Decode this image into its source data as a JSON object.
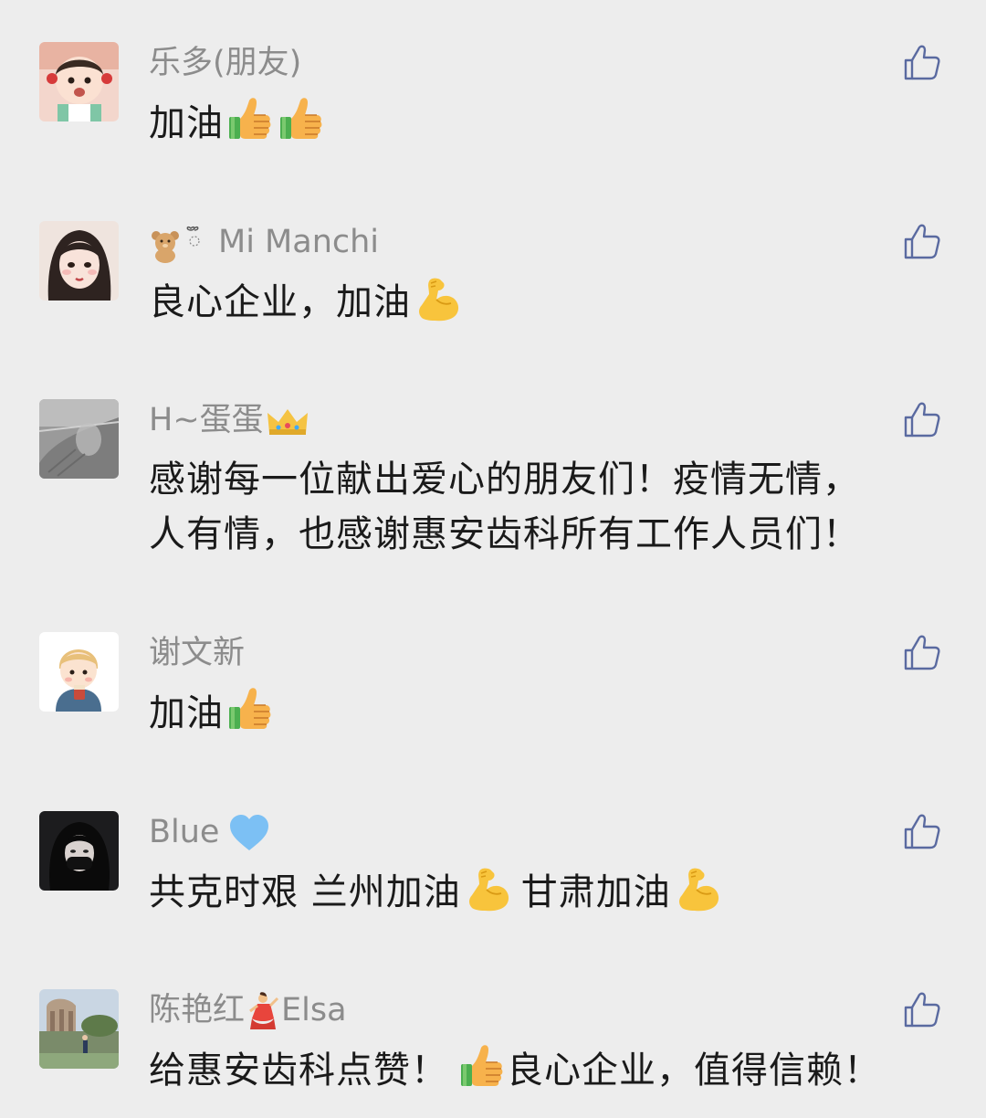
{
  "comments": [
    {
      "name": "乐多(朋友)",
      "text": "加油",
      "emojis": [
        "thumbs-up",
        "thumbs-up"
      ]
    },
    {
      "name_pre_emoji": "teddy-bear",
      "name": "Mi Manchi",
      "text": "良心企业，加油",
      "emojis": [
        "flexed-biceps"
      ]
    },
    {
      "name": "H~蛋蛋",
      "name_emoji": "crown",
      "text": "感谢每一位献出爱心的朋友们！疫情无情，",
      "text2": "人有情，也感谢惠安齿科所有工作人员们！"
    },
    {
      "name": "谢文新",
      "text": "加油",
      "emojis": [
        "thumbs-up"
      ]
    },
    {
      "name": "Blue",
      "name_emoji": "blue-heart",
      "text_a": "共克时艰 兰州加油",
      "text_b": "甘肃加油"
    },
    {
      "name_a": "陈艳红",
      "name_emoji": "dancer",
      "name_b": "Elsa",
      "text_a": "给惠安齿科点赞！",
      "text_b": "良心企业，值得信赖！"
    }
  ],
  "colors": {
    "background": "#ededed",
    "name": "#8c8c8c",
    "text": "#1a1a1a",
    "like_icon": "#5a6aa0"
  },
  "icons": {
    "like": "thumbs-up-outline-icon"
  }
}
